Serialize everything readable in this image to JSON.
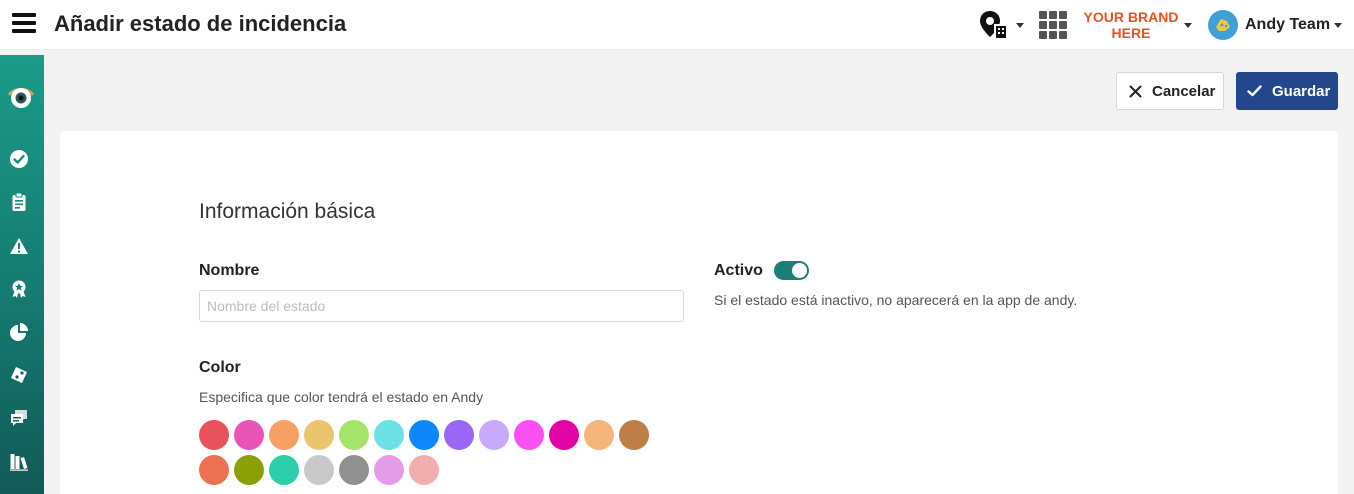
{
  "header": {
    "title": "Añadir estado de incidencia",
    "brand_line1": "YOUR BRAND",
    "brand_line2": "HERE",
    "user_name": "Andy Team",
    "brand_color": "#e8521e"
  },
  "sidebar": {
    "icons": [
      "eye-logo-icon",
      "check-circle-icon",
      "clipboard-icon",
      "warning-icon",
      "award-icon",
      "pie-chart-icon",
      "ticket-icon",
      "chat-icon",
      "books-icon"
    ],
    "accent_color": "#1b9b88"
  },
  "actions": {
    "cancel_label": "Cancelar",
    "save_label": "Guardar",
    "save_color": "#24468d"
  },
  "form": {
    "section_title": "Información básica",
    "name_label": "Nombre",
    "name_placeholder": "Nombre del estado",
    "name_value": "",
    "active_label": "Activo",
    "active_on": true,
    "active_help": "Si el estado está inactivo, no aparecerá en la app de andy.",
    "color_label": "Color",
    "color_help": "Especifica que color tendrá el estado en Andy",
    "colors": [
      "#e9525c",
      "#e955b6",
      "#f4a163",
      "#ebc56c",
      "#a4e569",
      "#6be0e5",
      "#0d87fa",
      "#9966f6",
      "#c8a9fb",
      "#fa50f3",
      "#e204a4",
      "#f4b57d",
      "#c07e47",
      "#ec7052",
      "#8aa005",
      "#2ccfa9",
      "#c9c9c9",
      "#909090",
      "#e49ce8",
      "#f2aeaf"
    ]
  }
}
